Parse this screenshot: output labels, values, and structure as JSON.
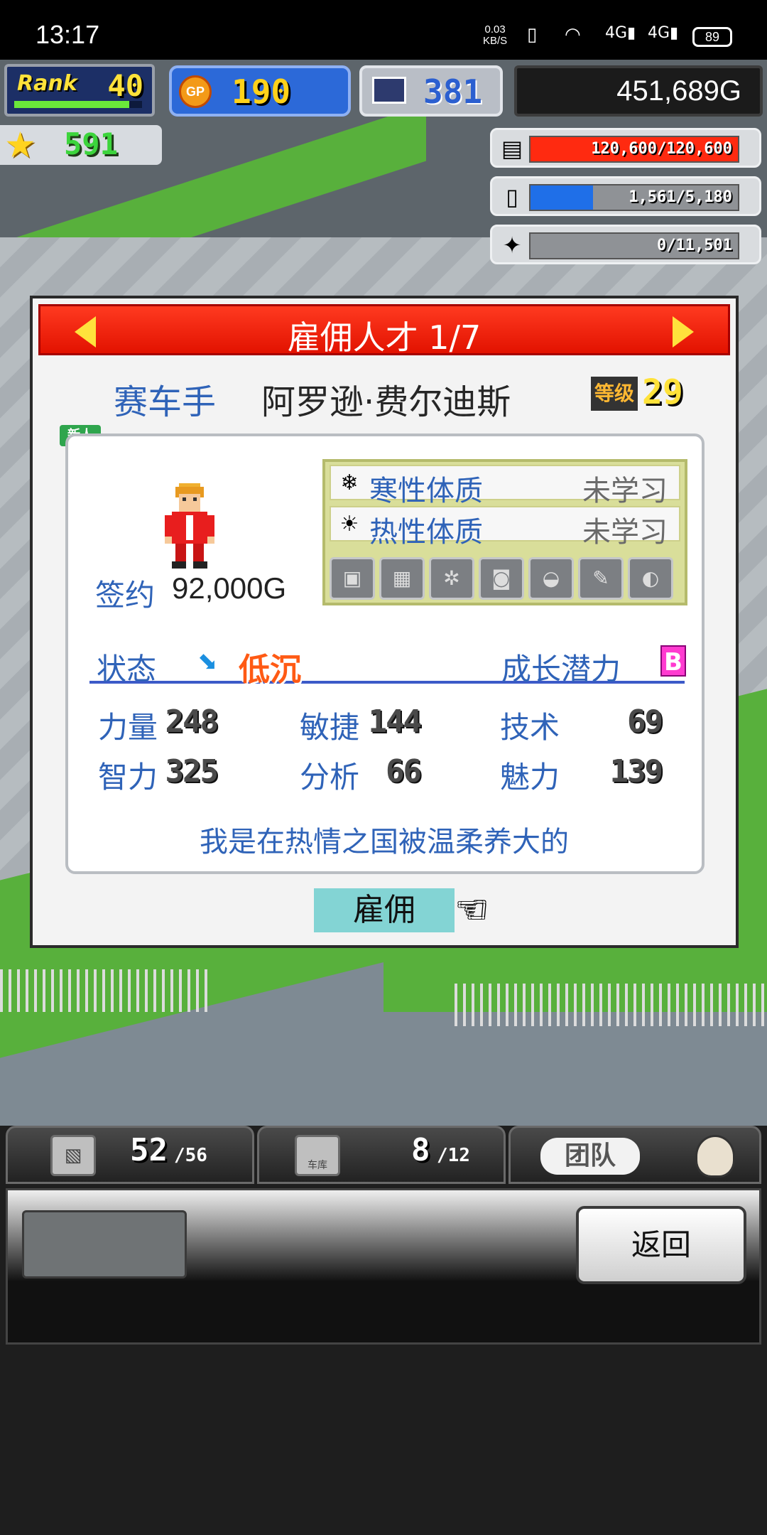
{
  "status_bar": {
    "time": "13:17",
    "net_speed": "0.03",
    "net_unit": "KB/S",
    "signal_label_1": "4G",
    "signal_label_2": "4G",
    "battery": "89"
  },
  "hud": {
    "rank_label": "Rank",
    "rank_value": "40",
    "rank_progress": 0.9,
    "gp_icon": "GP",
    "gp_value": "190",
    "pc_value": "381",
    "money": "451,689G",
    "star_value": "591",
    "resources": [
      {
        "icon": "fuel-icon",
        "text": "120,600/120,600",
        "fraction": 1.0,
        "color": "#ff2a10"
      },
      {
        "icon": "water-icon",
        "text": "1,561/5,180",
        "fraction": 0.3,
        "color": "#1f6fe8"
      },
      {
        "icon": "grain-icon",
        "text": "0/11,501",
        "fraction": 0.0,
        "color": "#e0a020"
      }
    ]
  },
  "dialog": {
    "title": "雇佣人才 1/7",
    "job": "赛车手",
    "name": "阿罗逊·费尔迪斯",
    "level_badge": "等级",
    "level": "29",
    "new_tag": "新人",
    "sign_label": "签约",
    "sign_value": "92,000G",
    "traits": [
      {
        "name": "寒性体质",
        "state": "未学习"
      },
      {
        "name": "热性体质",
        "state": "未学习"
      }
    ],
    "status_label": "状态",
    "mood": "低沉",
    "potential_label": "成长潜力",
    "potential_grade": "B",
    "stats": [
      {
        "label": "力量",
        "value": "248"
      },
      {
        "label": "敏捷",
        "value": "144"
      },
      {
        "label": "技术",
        "value": "69"
      },
      {
        "label": "智力",
        "value": "325"
      },
      {
        "label": "分析",
        "value": "66"
      },
      {
        "label": "魅力",
        "value": "139"
      }
    ],
    "quote": "我是在热情之国被温柔养大的",
    "hire_label": "雇佣"
  },
  "bottom": {
    "tab1_num": "52",
    "tab1_max": "/56",
    "tab2_icon_label": "车库",
    "tab2_num": "8",
    "tab2_max": "/12",
    "team_label": "团队",
    "back_label": "返回"
  }
}
